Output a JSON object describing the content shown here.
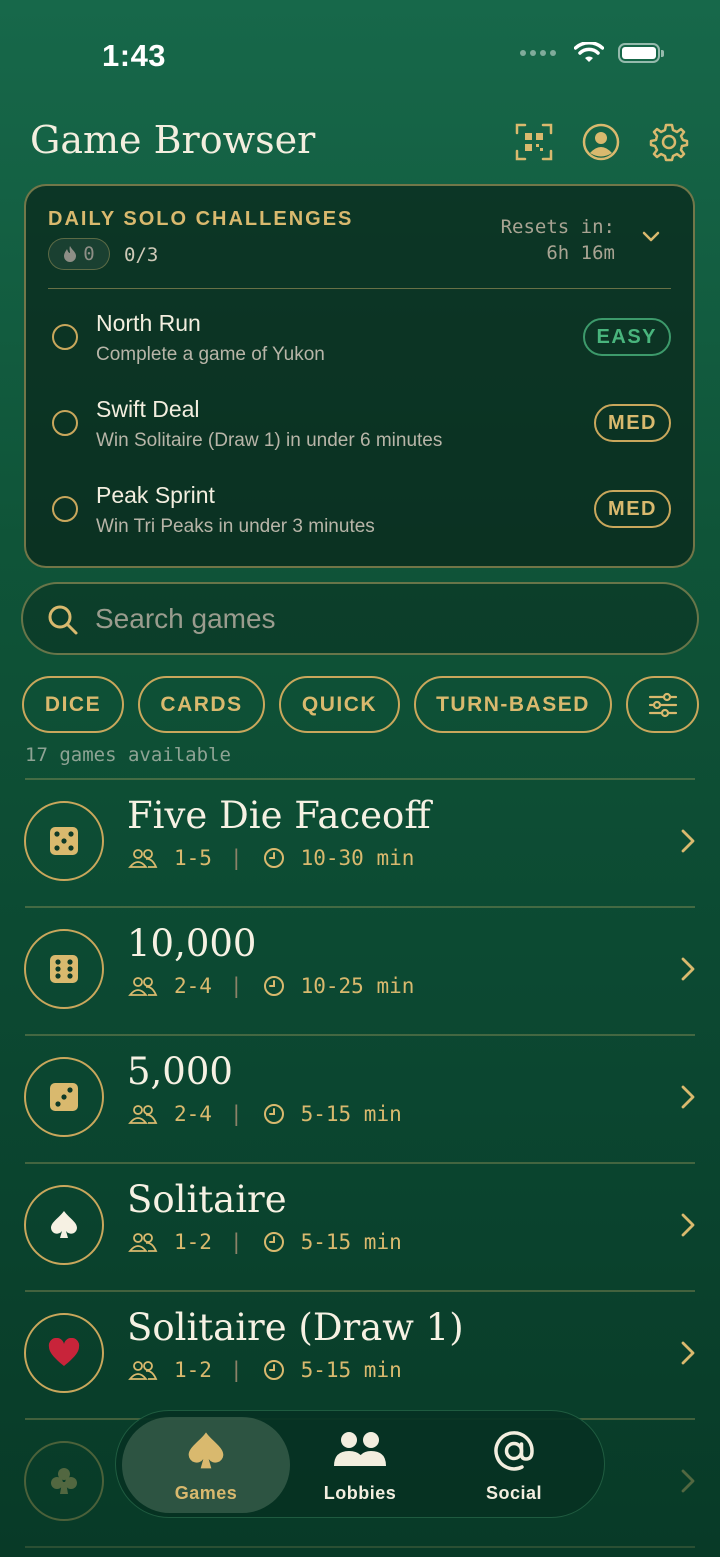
{
  "status_bar": {
    "time": "1:43"
  },
  "header": {
    "title": "Game Browser"
  },
  "challenges": {
    "title": "DAILY SOLO CHALLENGES",
    "streak": "0",
    "progress": "0/3",
    "resets_label": "Resets in:",
    "resets_value": "6h 16m",
    "items": [
      {
        "name": "North Run",
        "desc": "Complete a game of Yukon",
        "difficulty": "EASY"
      },
      {
        "name": "Swift Deal",
        "desc": "Win Solitaire (Draw 1) in under 6 minutes",
        "difficulty": "MED"
      },
      {
        "name": "Peak Sprint",
        "desc": "Win Tri Peaks in under 3 minutes",
        "difficulty": "MED"
      }
    ]
  },
  "search": {
    "placeholder": "Search games"
  },
  "filters": {
    "chips": [
      "DICE",
      "CARDS",
      "QUICK",
      "TURN-BASED"
    ]
  },
  "list": {
    "count": "17 games available",
    "games": [
      {
        "title": "Five Die Faceoff",
        "players": "1-5",
        "duration": "10-30 min",
        "icon": "dice-five-icon"
      },
      {
        "title": "10,000",
        "players": "2-4",
        "duration": "10-25 min",
        "icon": "dice-six-icon"
      },
      {
        "title": "5,000",
        "players": "2-4",
        "duration": "5-15 min",
        "icon": "dice-three-icon"
      },
      {
        "title": "Solitaire",
        "players": "1-2",
        "duration": "5-15 min",
        "icon": "spade-icon"
      },
      {
        "title": "Solitaire (Draw 1)",
        "players": "1-2",
        "duration": "5-15 min",
        "icon": "heart-icon"
      }
    ]
  },
  "tabbar": {
    "tabs": [
      {
        "label": "Games",
        "active": true
      },
      {
        "label": "Lobbies",
        "active": false
      },
      {
        "label": "Social",
        "active": false
      }
    ]
  },
  "colors": {
    "accent": "#d9b96e",
    "easy": "#49b57d",
    "heart": "#c8243a",
    "background": "#0f5438"
  }
}
